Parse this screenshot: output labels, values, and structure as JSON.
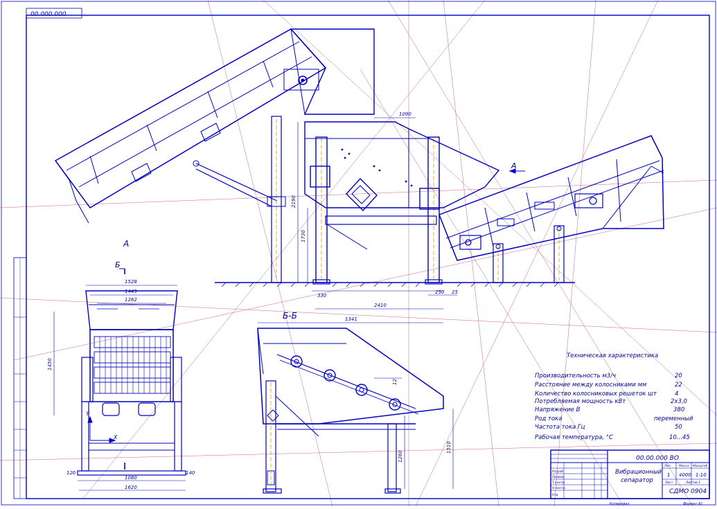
{
  "stamp_code": "00.000.000",
  "views": {
    "view_a": "А",
    "arrow_a": "А",
    "section_b_marker": "Б",
    "section_bb": "Б-Б"
  },
  "dimensions": {
    "top": [
      "1090",
      "2190",
      "1730",
      "330",
      "2410",
      "250",
      "25"
    ],
    "front": [
      "1528",
      "1445",
      "1262",
      "1450",
      "120",
      "1080",
      "140",
      "1620"
    ],
    "section": [
      "1341",
      "1260",
      "1510",
      "12"
    ]
  },
  "axes": {
    "x": "X",
    "y": "Y"
  },
  "specs": {
    "title": "Техническая характеристика",
    "rows": [
      {
        "label": "Производительность м3/ч",
        "value": "20"
      },
      {
        "label": "Расстояние между колосниками мм",
        "value": "22"
      },
      {
        "label": "Количество колосниковых решеток шт",
        "value": "4"
      },
      {
        "label": "Потребляемая мощность кВт",
        "value": "2x3,0"
      },
      {
        "label": "Напряжение В",
        "value": "380"
      },
      {
        "label": "Род тока",
        "value": "переменный"
      },
      {
        "label": "Частота тока Гц",
        "value": "50"
      },
      {
        "label": "Рабочая температура, °С",
        "value": "10...45"
      }
    ]
  },
  "title_block": {
    "doc_number": "00.00.000 ВО",
    "name_line1": "Вибрационный",
    "name_line2": "сепаратор",
    "sheet_cell": "1",
    "mass": "4000",
    "scale": "1:10",
    "organization": "СДМО 0904",
    "copy_label": "Копировал",
    "format_label": "Формат А1",
    "role_labels": [
      "Разраб.",
      "Провер.",
      "Т.контр.",
      "Н.контр.",
      "Утв."
    ],
    "column_labels": [
      "Лит.",
      "Масса",
      "Масштаб"
    ],
    "sheet_label": "Лист",
    "sheets_label": "Листов 1"
  }
}
